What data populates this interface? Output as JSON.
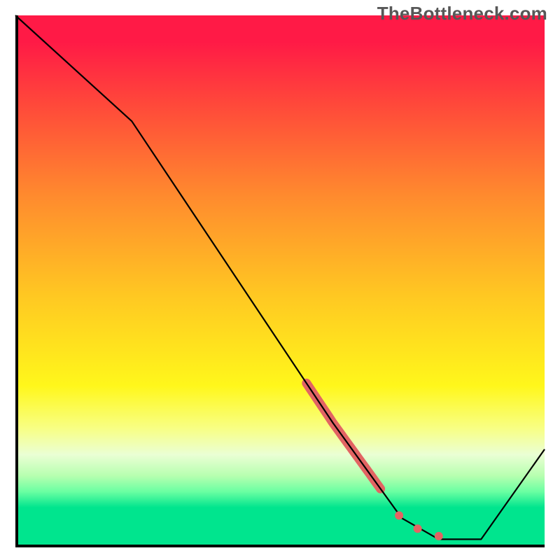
{
  "watermark": "TheBottleneck.com",
  "chart_data": {
    "type": "line",
    "title": "",
    "xlabel": "",
    "ylabel": "",
    "xlim": [
      0,
      100
    ],
    "ylim": [
      0,
      100
    ],
    "curve": [
      {
        "x": 0,
        "y": 100
      },
      {
        "x": 22,
        "y": 80
      },
      {
        "x": 60,
        "y": 23
      },
      {
        "x": 73,
        "y": 5
      },
      {
        "x": 80,
        "y": 1
      },
      {
        "x": 88,
        "y": 1
      },
      {
        "x": 100,
        "y": 18
      }
    ],
    "highlighted_segment": {
      "x_start": 55,
      "x_end": 69
    },
    "points": [
      {
        "x": 72.5,
        "y": 5.5
      },
      {
        "x": 76,
        "y": 3
      },
      {
        "x": 80,
        "y": 1.6
      }
    ],
    "background_gradient_desc": "vertical heat gradient red→orange→yellow→green",
    "colors": {
      "curve": "#000000",
      "highlight": "#e26463",
      "axis": "#000000"
    }
  }
}
